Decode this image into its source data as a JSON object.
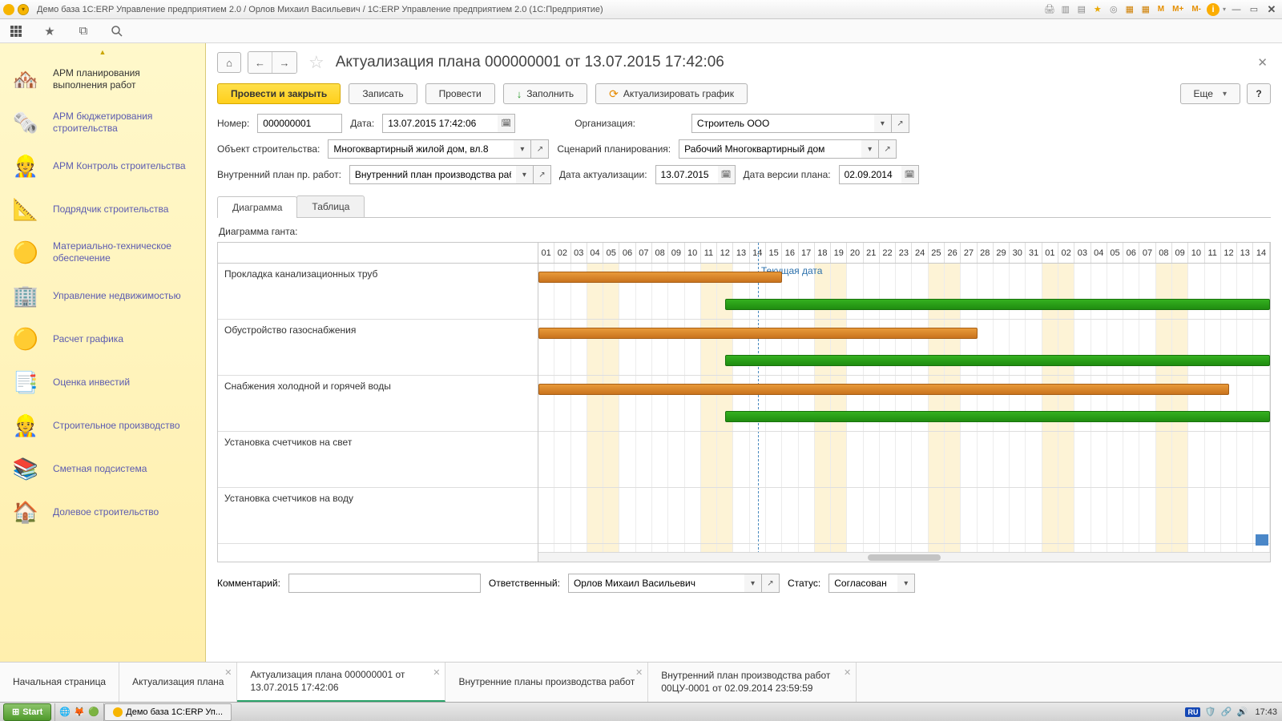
{
  "titlebar": {
    "text": "Демо база 1С:ERP Управление предприятием 2.0 / Орлов Михаил Васильевич / 1С:ERP Управление предприятием 2.0  (1С:Предприятие)",
    "m_buttons": [
      "M",
      "M+",
      "M-"
    ]
  },
  "sidebar": {
    "items": [
      {
        "label": "АРМ планирования выполнения работ",
        "icon": "🏘️"
      },
      {
        "label": "АРМ бюджетирования строительства",
        "icon": "🗞️"
      },
      {
        "label": "АРМ Контроль строительства",
        "icon": "👷"
      },
      {
        "label": "Подрядчик строительства",
        "icon": "📐"
      },
      {
        "label": "Материально-техническое обеспечение",
        "icon": "🟡"
      },
      {
        "label": "Управление недвижимостью",
        "icon": "🏢"
      },
      {
        "label": "Расчет графика",
        "icon": "🟡"
      },
      {
        "label": "Оценка инвестий",
        "icon": "📑"
      },
      {
        "label": "Строительное производство",
        "icon": "👷"
      },
      {
        "label": "Сметная подсистема",
        "icon": "📚"
      },
      {
        "label": "Долевое строительство",
        "icon": "🏠"
      }
    ]
  },
  "page": {
    "title": "Актуализация плана 000000001 от 13.07.2015 17:42:06"
  },
  "actions": {
    "submit_close": "Провести и закрыть",
    "save": "Записать",
    "submit": "Провести",
    "fill": "Заполнить",
    "update_chart": "Актуализировать график",
    "more": "Еще",
    "help": "?"
  },
  "form": {
    "number_lbl": "Номер:",
    "number": "000000001",
    "date_lbl": "Дата:",
    "date": "13.07.2015 17:42:06",
    "org_lbl": "Организация:",
    "org": "Строитель ООО",
    "object_lbl": "Объект строительства:",
    "object": "Многоквартирный жилой дом, вл.8",
    "scenario_lbl": "Сценарий планирования:",
    "scenario": "Рабочий Многоквартирный дом",
    "innerplan_lbl": "Внутренний план пр. работ:",
    "innerplan": "Внутренний план производства работ I",
    "actdate_lbl": "Дата актуализации:",
    "actdate": "13.07.2015",
    "verdate_lbl": "Дата версии плана:",
    "verdate": "02.09.2014"
  },
  "tabs": {
    "diagram": "Диаграмма",
    "table": "Таблица"
  },
  "gantt": {
    "title": "Диаграмма ганта:",
    "today_label": "Текущая дата",
    "tasks": [
      "Прокладка канализационных труб",
      "Обустройство газоснабжения",
      "Снабжения холодной и горячей воды",
      "Установка счетчиков на свет",
      "Установка счетчиков на воду"
    ]
  },
  "bottom": {
    "comment_lbl": "Комментарий:",
    "responsible_lbl": "Ответственный:",
    "responsible": "Орлов Михаил Васильевич",
    "status_lbl": "Статус:",
    "status": "Согласован"
  },
  "doctabs": [
    {
      "label": "Начальная страница",
      "closable": false
    },
    {
      "label": "Актуализация плана",
      "closable": true
    },
    {
      "label": "Актуализация плана 000000001 от 13.07.2015 17:42:06",
      "closable": true,
      "active": true
    },
    {
      "label": "Внутренние планы производства работ",
      "closable": true
    },
    {
      "label": "Внутренний план производства работ 00ЦУ-0001 от 02.09.2014 23:59:59",
      "closable": true
    }
  ],
  "taskbar": {
    "start": "Start",
    "app": "Демо база 1С:ERP Уп...",
    "lang": "RU",
    "time": "17:43"
  },
  "chart_data": {
    "type": "bar",
    "title": "Диаграмма ганта",
    "x_days": [
      "01",
      "02",
      "03",
      "04",
      "05",
      "06",
      "07",
      "08",
      "09",
      "10",
      "11",
      "12",
      "13",
      "14",
      "15",
      "16",
      "17",
      "18",
      "19",
      "20",
      "21",
      "22",
      "23",
      "24",
      "25",
      "26",
      "27",
      "28",
      "29",
      "30",
      "31",
      "01",
      "02",
      "03",
      "04",
      "05",
      "06",
      "07",
      "08",
      "09",
      "10",
      "11",
      "12",
      "13",
      "14"
    ],
    "weekend_indices": [
      3,
      4,
      10,
      11,
      17,
      18,
      24,
      25,
      31,
      32,
      38,
      39
    ],
    "today_index": 13.5,
    "series": [
      {
        "name": "Прокладка канализационных труб",
        "plan": [
          0,
          15
        ],
        "fact": [
          11.5,
          45
        ]
      },
      {
        "name": "Обустройство газоснабжения",
        "plan": [
          0,
          27
        ],
        "fact": [
          11.5,
          45
        ]
      },
      {
        "name": "Снабжения холодной и горячей воды",
        "plan": [
          0,
          42.5
        ],
        "fact": [
          11.5,
          45
        ]
      },
      {
        "name": "Установка счетчиков на свет",
        "plan": null,
        "fact": null
      },
      {
        "name": "Установка счетчиков на воду",
        "plan": null,
        "fact": null
      }
    ]
  }
}
